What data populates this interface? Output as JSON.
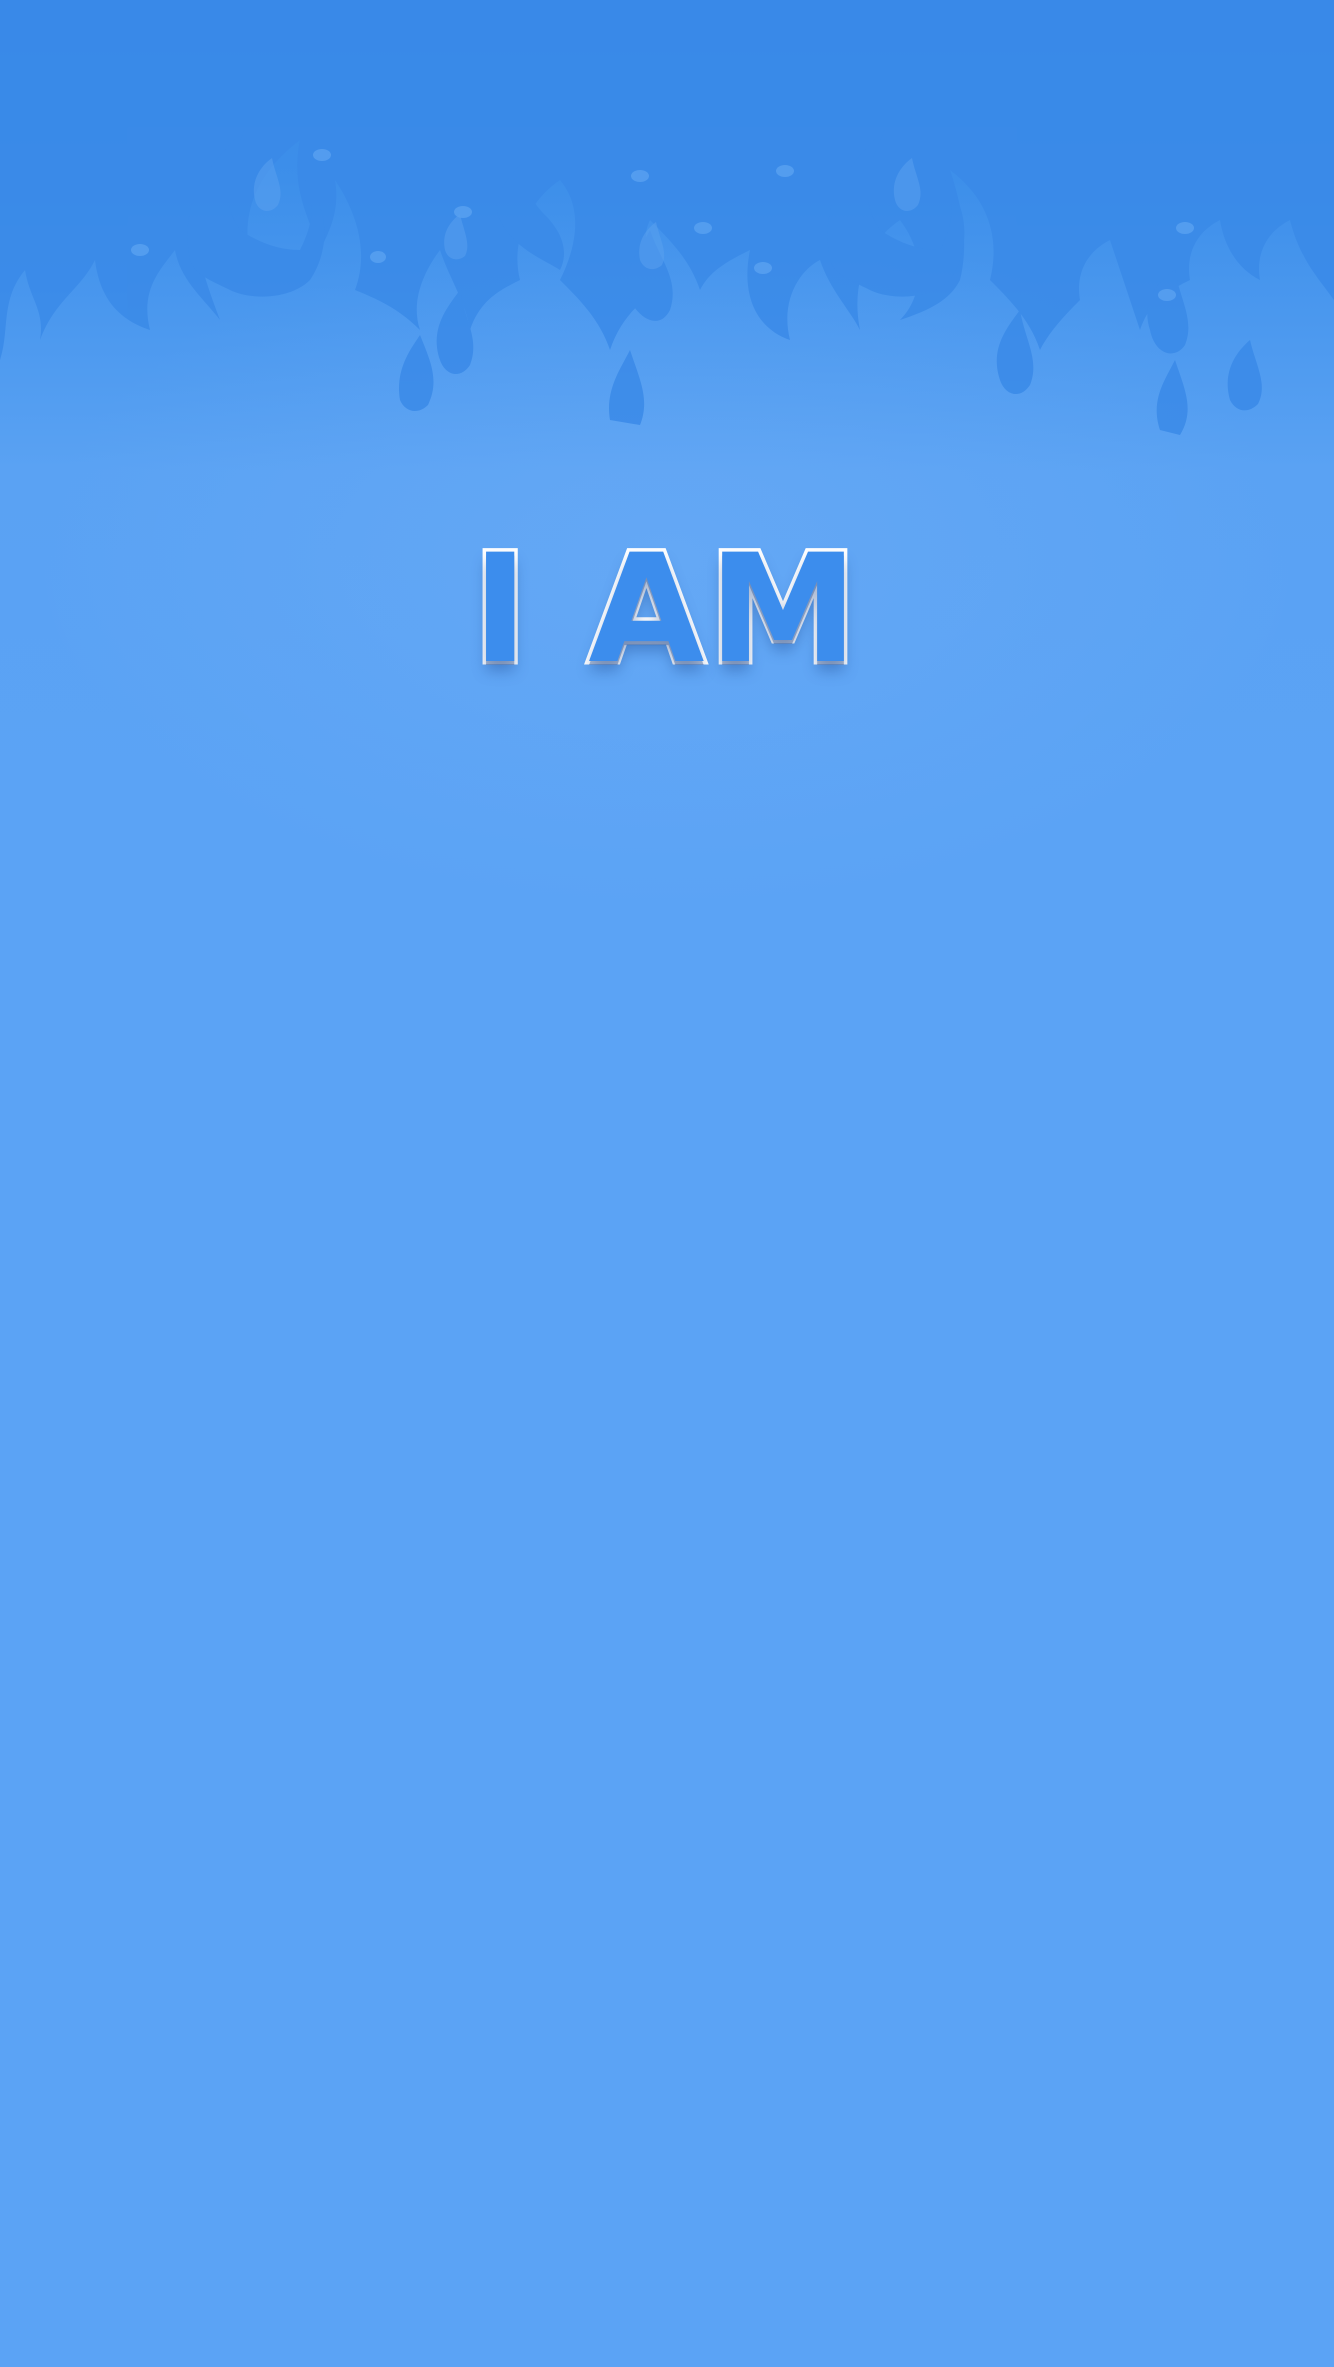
{
  "screen": {
    "title": "I AM"
  },
  "colors": {
    "background_top": "#3587e6",
    "background_main": "#5ba3f5",
    "flame": "#3a8ae8",
    "title_fill": "#3c8ded",
    "title_outline": "#ffffff"
  },
  "decor": {
    "header_art": "blue-flames-icon"
  }
}
